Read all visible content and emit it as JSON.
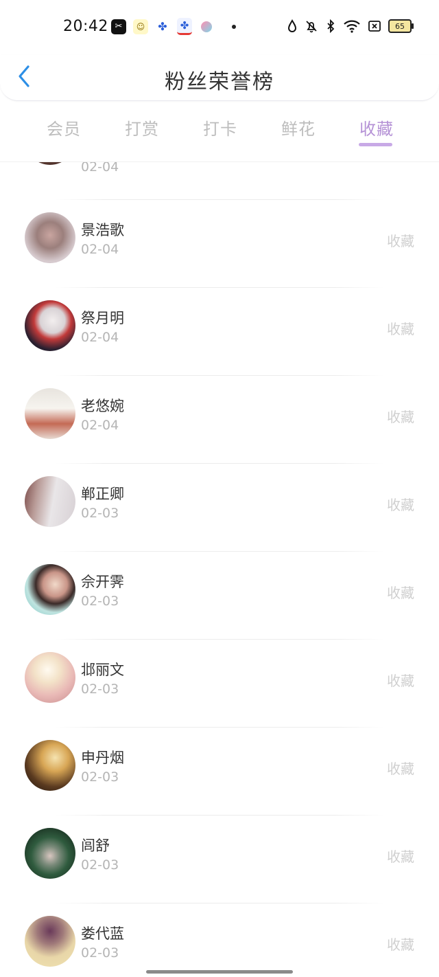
{
  "status_bar": {
    "time": "20:42",
    "battery": "65",
    "icons_left": [
      "capcut-icon",
      "chick-app-icon",
      "baidu-icon",
      "baidu-netdisk-icon",
      "bubble-app-icon",
      "notification-dot-icon"
    ],
    "icons_right": [
      "water-drop-icon",
      "bell-off-icon",
      "bluetooth-icon",
      "wifi-icon",
      "sim-x-icon",
      "battery-icon"
    ]
  },
  "header": {
    "title": "粉丝荣誉榜",
    "back_icon": "chevron-left-icon"
  },
  "tabs": [
    {
      "label": "会员",
      "active": false
    },
    {
      "label": "打赏",
      "active": false
    },
    {
      "label": "打卡",
      "active": false
    },
    {
      "label": "鲜花",
      "active": false
    },
    {
      "label": "收藏",
      "active": true
    }
  ],
  "list": {
    "partial_top": {
      "date": "02-04"
    },
    "items": [
      {
        "name": "景浩歌",
        "date": "02-04",
        "action": "收藏"
      },
      {
        "name": "祭月明",
        "date": "02-04",
        "action": "收藏"
      },
      {
        "name": "老悠婉",
        "date": "02-04",
        "action": "收藏"
      },
      {
        "name": "郸正卿",
        "date": "02-03",
        "action": "收藏"
      },
      {
        "name": "佘开霁",
        "date": "02-03",
        "action": "收藏"
      },
      {
        "name": "邶丽文",
        "date": "02-03",
        "action": "收藏"
      },
      {
        "name": "申丹烟",
        "date": "02-03",
        "action": "收藏"
      },
      {
        "name": "闾舒",
        "date": "02-03",
        "action": "收藏"
      },
      {
        "name": "娄代蓝",
        "date": "02-03",
        "action": "收藏"
      }
    ]
  },
  "colors": {
    "accent": "#b592d6",
    "tab_inactive": "#bdbdbd",
    "back_icon": "#2d8fe6",
    "date_text": "#b5b5b5",
    "action_text": "#cfcfcf"
  }
}
